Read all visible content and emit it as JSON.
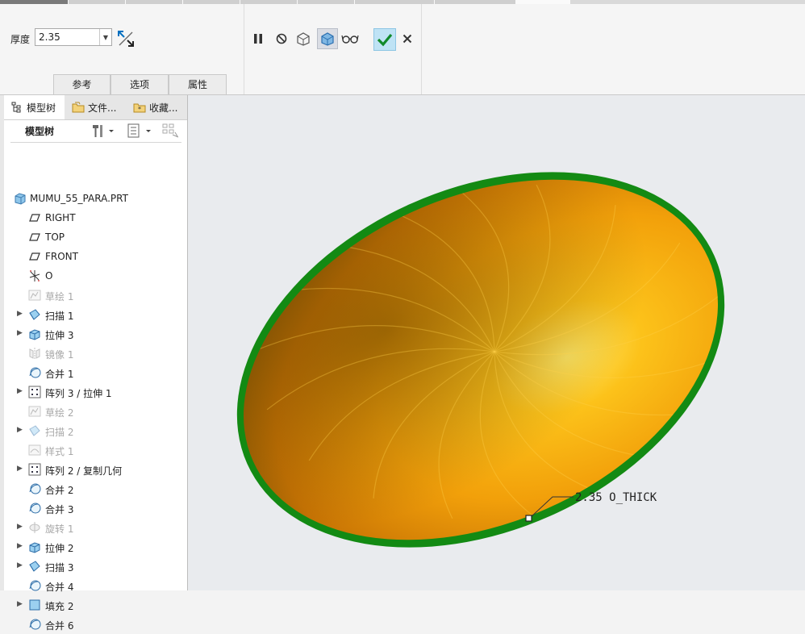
{
  "ribbon": {
    "thickness_label": "厚度",
    "thickness_value": "2.35",
    "subtabs": [
      "参考",
      "选项",
      "属性"
    ]
  },
  "panel": {
    "tabs": [
      "模型树",
      "文件...",
      "收藏..."
    ],
    "tree_title": "模型树",
    "root": "MUMU_55_PARA.PRT",
    "items": [
      {
        "label": "RIGHT",
        "icon": "datum-plane-icon",
        "expandable": false,
        "dim": false
      },
      {
        "label": "TOP",
        "icon": "datum-plane-icon",
        "expandable": false,
        "dim": false
      },
      {
        "label": "FRONT",
        "icon": "datum-plane-icon",
        "expandable": false,
        "dim": false
      },
      {
        "label": "O",
        "icon": "coordinate-system-icon",
        "expandable": false,
        "dim": false
      },
      {
        "label": "草绘 1",
        "icon": "sketch-icon",
        "expandable": false,
        "dim": true
      },
      {
        "label": "扫描 1",
        "icon": "sweep-icon",
        "expandable": true,
        "dim": false
      },
      {
        "label": "拉伸 3",
        "icon": "extrude-icon",
        "expandable": true,
        "dim": false
      },
      {
        "label": "镜像 1",
        "icon": "mirror-icon",
        "expandable": false,
        "dim": true
      },
      {
        "label": "合并 1",
        "icon": "merge-icon",
        "expandable": false,
        "dim": false
      },
      {
        "label": "阵列 3 / 拉伸 1",
        "icon": "pattern-icon",
        "expandable": true,
        "dim": false
      },
      {
        "label": "草绘 2",
        "icon": "sketch-icon",
        "expandable": false,
        "dim": true
      },
      {
        "label": "扫描 2",
        "icon": "sweep-icon",
        "expandable": true,
        "dim": true
      },
      {
        "label": "样式 1",
        "icon": "style-icon",
        "expandable": false,
        "dim": true
      },
      {
        "label": "阵列 2 / 复制几何",
        "icon": "pattern-icon",
        "expandable": true,
        "dim": false
      },
      {
        "label": "合并 2",
        "icon": "merge-icon",
        "expandable": false,
        "dim": false
      },
      {
        "label": "合并 3",
        "icon": "merge-icon",
        "expandable": false,
        "dim": false
      },
      {
        "label": "旋转 1",
        "icon": "revolve-icon",
        "expandable": true,
        "dim": true
      },
      {
        "label": "拉伸 2",
        "icon": "extrude-icon",
        "expandable": true,
        "dim": false
      },
      {
        "label": "扫描 3",
        "icon": "sweep-icon",
        "expandable": true,
        "dim": false
      },
      {
        "label": "合并 4",
        "icon": "merge-icon",
        "expandable": false,
        "dim": false
      },
      {
        "label": "填充 2",
        "icon": "fill-icon",
        "expandable": true,
        "dim": false
      },
      {
        "label": "合并 6",
        "icon": "merge-icon",
        "expandable": false,
        "dim": false
      }
    ]
  },
  "viewport": {
    "dimension_label": "2.35 O_THICK",
    "colors": {
      "shell": "#f3a20a",
      "edge": "#138a13",
      "background": "#e9ebee"
    }
  }
}
